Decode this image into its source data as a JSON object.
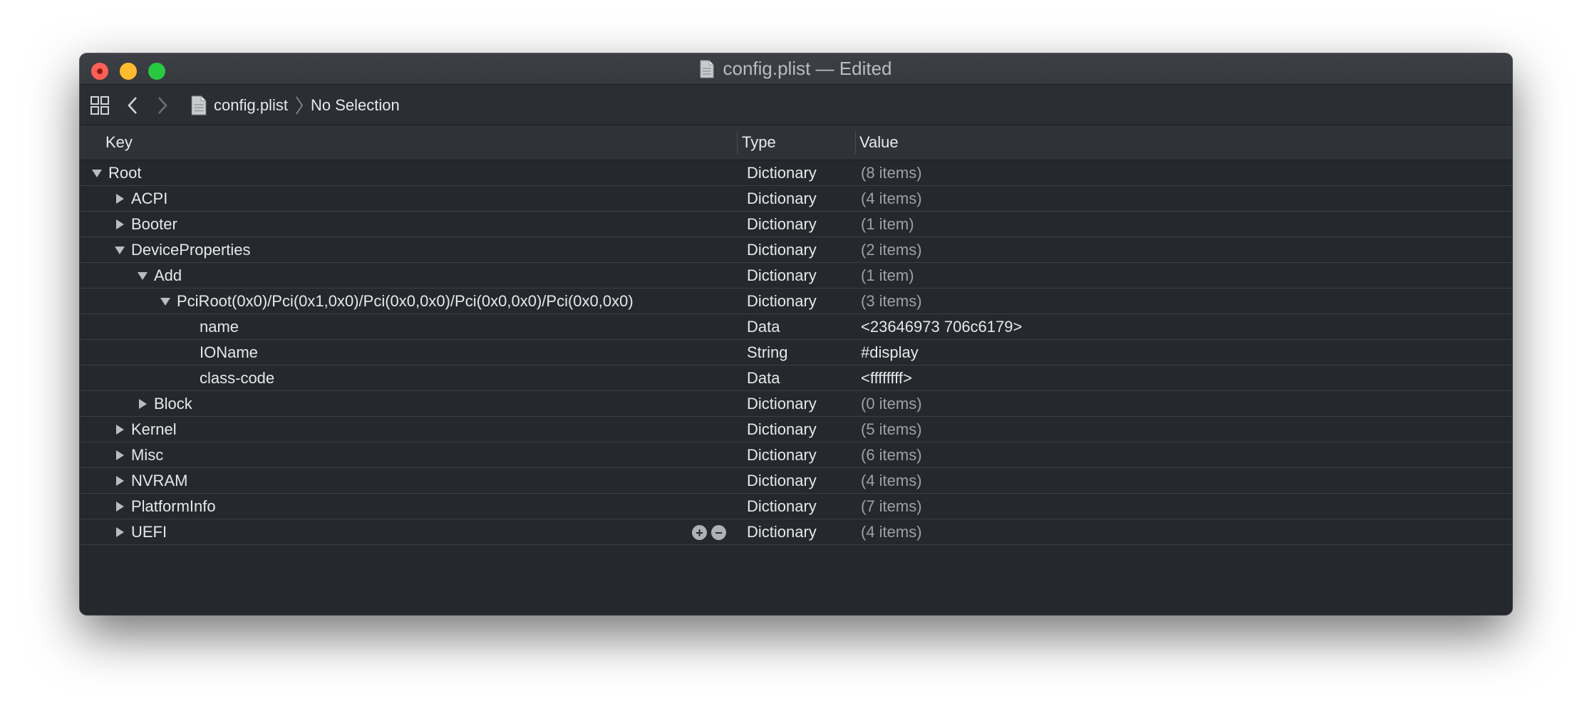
{
  "window": {
    "title": "config.plist — Edited"
  },
  "toolbar": {
    "grid_icon": "grid-icon",
    "back_icon": "chevron-left-icon",
    "forward_icon": "chevron-right-icon",
    "file_label": "config.plist",
    "selection_label": "No Selection"
  },
  "columns": {
    "key": "Key",
    "type": "Type",
    "value": "Value"
  },
  "rows": [
    {
      "key": "Root",
      "type": "Dictionary",
      "value": "(8 items)",
      "level": 0,
      "toggle": "open"
    },
    {
      "key": "ACPI",
      "type": "Dictionary",
      "value": "(4 items)",
      "level": 1,
      "toggle": "closed"
    },
    {
      "key": "Booter",
      "type": "Dictionary",
      "value": "(1 item)",
      "level": 1,
      "toggle": "closed"
    },
    {
      "key": "DeviceProperties",
      "type": "Dictionary",
      "value": "(2 items)",
      "level": 1,
      "toggle": "open"
    },
    {
      "key": "Add",
      "type": "Dictionary",
      "value": "(1 item)",
      "level": 2,
      "toggle": "open"
    },
    {
      "key": "PciRoot(0x0)/Pci(0x1,0x0)/Pci(0x0,0x0)/Pci(0x0,0x0)/Pci(0x0,0x0)",
      "type": "Dictionary",
      "value": "(3 items)",
      "level": 3,
      "toggle": "open"
    },
    {
      "key": "name",
      "type": "Data",
      "value": "<23646973 706c6179>",
      "level": 4,
      "toggle": "none"
    },
    {
      "key": "IOName",
      "type": "String",
      "value": "#display",
      "level": 4,
      "toggle": "none"
    },
    {
      "key": "class-code",
      "type": "Data",
      "value": "<ffffffff>",
      "level": 4,
      "toggle": "none"
    },
    {
      "key": "Block",
      "type": "Dictionary",
      "value": "(0 items)",
      "level": 2,
      "toggle": "closed"
    },
    {
      "key": "Kernel",
      "type": "Dictionary",
      "value": "(5 items)",
      "level": 1,
      "toggle": "closed"
    },
    {
      "key": "Misc",
      "type": "Dictionary",
      "value": "(6 items)",
      "level": 1,
      "toggle": "closed"
    },
    {
      "key": "NVRAM",
      "type": "Dictionary",
      "value": "(4 items)",
      "level": 1,
      "toggle": "closed"
    },
    {
      "key": "PlatformInfo",
      "type": "Dictionary",
      "value": "(7 items)",
      "level": 1,
      "toggle": "closed"
    },
    {
      "key": "UEFI",
      "type": "Dictionary",
      "value": "(4 items)",
      "level": 1,
      "toggle": "closed",
      "row_buttons": [
        "+",
        "−"
      ]
    }
  ],
  "colors": {
    "background": "#25282c",
    "header": "#2f3237",
    "text": "#e6e8ea",
    "muted": "#9ea1a6",
    "close": "#ff5f57",
    "minimize": "#febc2e",
    "zoom": "#28c840"
  }
}
